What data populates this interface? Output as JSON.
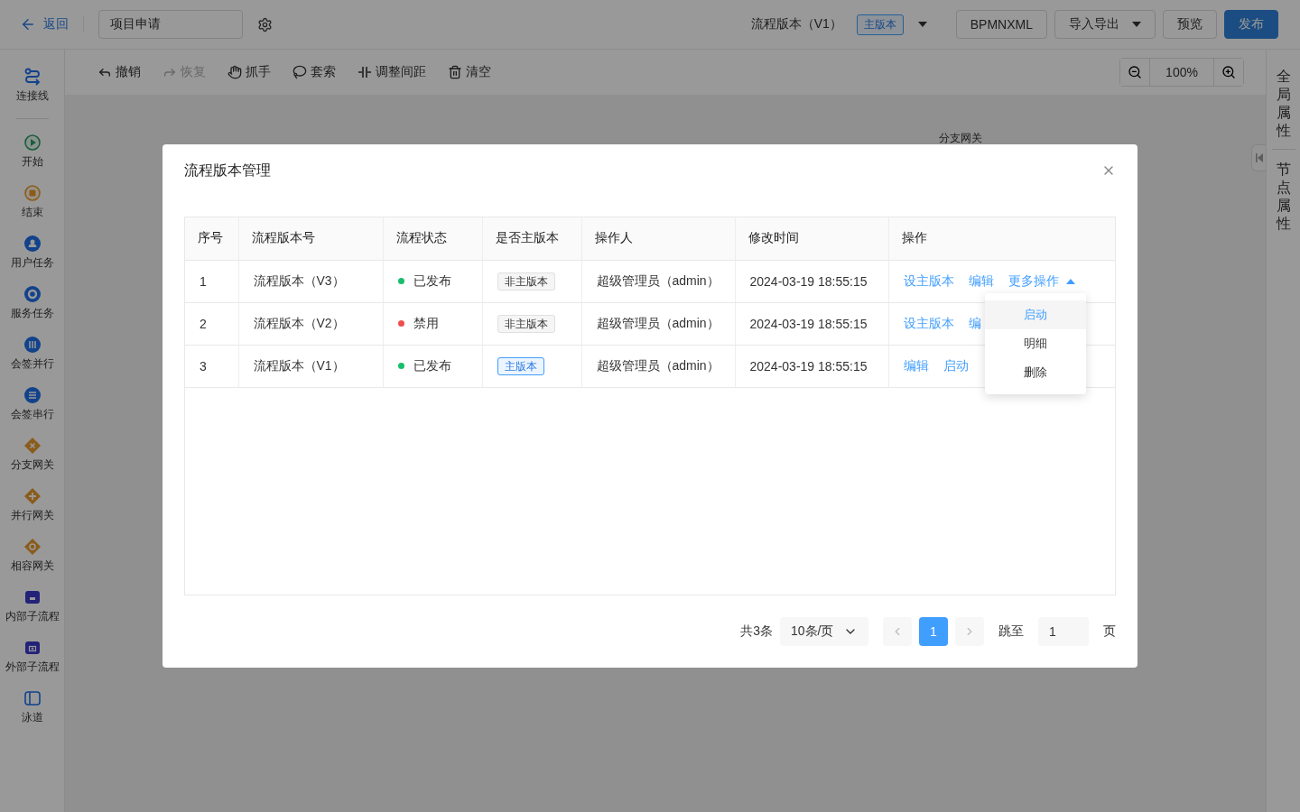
{
  "header": {
    "back": "返回",
    "process_name": "项目申请",
    "version_label": "流程版本（V1）",
    "version_tag": "主版本",
    "buttons": [
      {
        "label": "BPMNXML",
        "kind": "default"
      },
      {
        "label": "导入导出",
        "kind": "dropdown"
      },
      {
        "label": "预览",
        "kind": "default"
      },
      {
        "label": "发布",
        "kind": "primary"
      }
    ]
  },
  "sidebar": {
    "items": [
      {
        "label": "连接线",
        "kind": "connector"
      },
      {
        "label": "开始",
        "kind": "start"
      },
      {
        "label": "结束",
        "kind": "end"
      },
      {
        "label": "用户任务",
        "kind": "user"
      },
      {
        "label": "服务任务",
        "kind": "service"
      },
      {
        "label": "会签并行",
        "kind": "parallel-sign"
      },
      {
        "label": "会签串行",
        "kind": "serial-sign"
      },
      {
        "label": "分支网关",
        "kind": "exclusive"
      },
      {
        "label": "并行网关",
        "kind": "parallel"
      },
      {
        "label": "相容网关",
        "kind": "inclusive"
      },
      {
        "label": "内部子流程",
        "kind": "subprocess"
      },
      {
        "label": "外部子流程",
        "kind": "call"
      },
      {
        "label": "泳道",
        "kind": "lane"
      }
    ]
  },
  "toolbar": {
    "actions": [
      {
        "label": "撤销",
        "kind": "undo",
        "disabled": false
      },
      {
        "label": "恢复",
        "kind": "redo",
        "disabled": true
      },
      {
        "label": "抓手",
        "kind": "hand",
        "disabled": false
      },
      {
        "label": "套索",
        "kind": "lasso",
        "disabled": false
      },
      {
        "label": "调整间距",
        "kind": "space",
        "disabled": false
      },
      {
        "label": "清空",
        "kind": "clear",
        "disabled": false
      }
    ],
    "zoom": "100%"
  },
  "canvas": {
    "node_label": "分支网关"
  },
  "right_panel": {
    "tabs": [
      "全局属性",
      "节点属性"
    ]
  },
  "dialog": {
    "title": "流程版本管理",
    "table": {
      "columns": [
        "序号",
        "流程版本号",
        "流程状态",
        "是否主版本",
        "操作人",
        "修改时间",
        "操作"
      ],
      "rows": [
        {
          "index": "1",
          "version": "流程版本（V3）",
          "status": {
            "text": "已发布",
            "color": "#19be6b"
          },
          "main": {
            "text": "非主版本",
            "kind": "normal"
          },
          "operator": "超级管理员（admin）",
          "modified": "2024-03-19 18:55:15",
          "actions": [
            {
              "label": "设主版本",
              "kind": "link"
            },
            {
              "label": "编辑",
              "kind": "link"
            },
            {
              "label": "更多操作",
              "kind": "menu",
              "expanded": true
            }
          ]
        },
        {
          "index": "2",
          "version": "流程版本（V2）",
          "status": {
            "text": "禁用",
            "color": "#ed4f4f"
          },
          "main": {
            "text": "非主版本",
            "kind": "normal"
          },
          "operator": "超级管理员（admin）",
          "modified": "2024-03-19 18:55:15",
          "actions": [
            {
              "label": "设主版本",
              "kind": "link"
            },
            {
              "label": "编",
              "kind": "link"
            }
          ]
        },
        {
          "index": "3",
          "version": "流程版本（V1）",
          "status": {
            "text": "已发布",
            "color": "#19be6b"
          },
          "main": {
            "text": "主版本",
            "kind": "main"
          },
          "operator": "超级管理员（admin）",
          "modified": "2024-03-19 18:55:15",
          "actions": [
            {
              "label": "编辑",
              "kind": "link"
            },
            {
              "label": "启动",
              "kind": "link"
            }
          ]
        }
      ]
    },
    "menu": {
      "items": [
        {
          "label": "启动",
          "selected": true
        },
        {
          "label": "明细",
          "selected": false
        },
        {
          "label": "删除",
          "selected": false
        }
      ]
    },
    "pagination": {
      "total": "共3条",
      "page_size": "10条/页",
      "pages": [
        {
          "label": "1",
          "selected": true
        }
      ],
      "jump_label": "跳至",
      "jump_value": "1",
      "page_suffix": "页"
    }
  }
}
